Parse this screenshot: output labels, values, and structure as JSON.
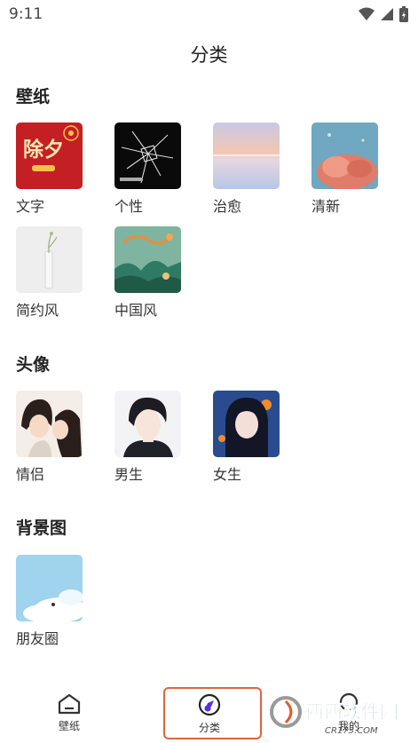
{
  "status": {
    "time": "9:11"
  },
  "header": {
    "title": "分类"
  },
  "sections": [
    {
      "title": "壁纸",
      "items": [
        {
          "label": "文字",
          "thumb_text": "除夕"
        },
        {
          "label": "个性"
        },
        {
          "label": "治愈"
        },
        {
          "label": "清新"
        },
        {
          "label": "简约风"
        },
        {
          "label": "中国风"
        }
      ]
    },
    {
      "title": "头像",
      "items": [
        {
          "label": "情侣"
        },
        {
          "label": "男生"
        },
        {
          "label": "女生"
        }
      ]
    },
    {
      "title": "背景图",
      "items": [
        {
          "label": "朋友圈"
        }
      ]
    }
  ],
  "tabbar": {
    "tabs": [
      {
        "label": "壁纸",
        "icon": "home-icon"
      },
      {
        "label": "分类",
        "icon": "compass-icon",
        "active": true
      },
      {
        "label": "我的",
        "icon": "profile-icon"
      }
    ]
  },
  "watermark": {
    "text": "西西软件园",
    "sub": "CR173.COM"
  },
  "colors": {
    "highlight": "#e0643c",
    "active_icon": "#5a2ee6",
    "brand_red": "#d3352a"
  }
}
